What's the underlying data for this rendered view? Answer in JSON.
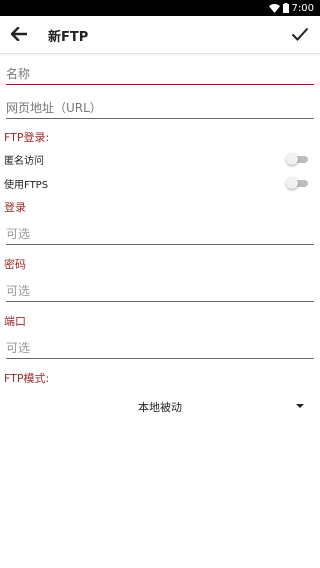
{
  "status_bar": {
    "time": "7:00",
    "icons": [
      "wifi-icon",
      "battery-icon"
    ]
  },
  "app_bar": {
    "title": "新FTP",
    "back_icon": "arrow-left-icon",
    "confirm_icon": "check-icon"
  },
  "form": {
    "name_placeholder": "名称",
    "url_placeholder": "网页地址（URL）",
    "ftp_login_label": "FTP登录:",
    "anonymous_label": "匿名访问",
    "anonymous_enabled": false,
    "ftps_label": "使用FTPS",
    "ftps_enabled": false,
    "login_label": "登录",
    "login_placeholder": "可选",
    "password_label": "密码",
    "password_placeholder": "可选",
    "port_label": "端口",
    "port_placeholder": "可选",
    "ftp_mode_label": "FTP模式:",
    "ftp_mode_value": "本地被动"
  },
  "colors": {
    "accent": "#9b2a2a",
    "status_bar": "#000000",
    "switch_off": "#bdbdbd"
  }
}
